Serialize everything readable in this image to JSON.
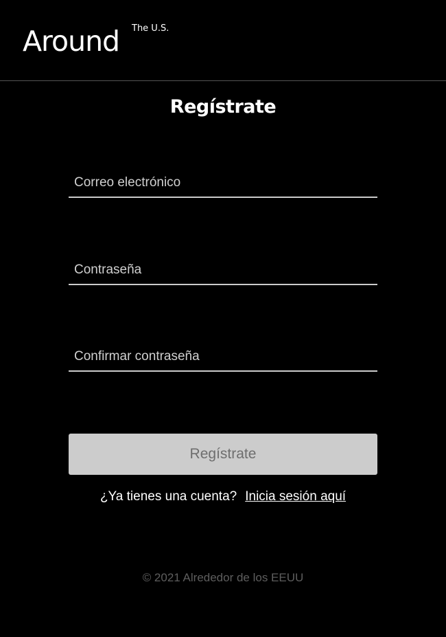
{
  "header": {
    "logo_text": "Around",
    "logo_superscript": "The U.S."
  },
  "form": {
    "title": "Regístrate",
    "email_placeholder": "Correo electrónico",
    "password_placeholder": "Contraseña",
    "confirm_password_placeholder": "Confirmar contraseña",
    "email_value": "",
    "password_value": "",
    "confirm_password_value": "",
    "submit_label": "Regístrate",
    "has_account_text": "¿Ya tienes una cuenta?",
    "login_link_text": "Inicia sesión aquí"
  },
  "footer": {
    "copyright": "© 2021 Alrededor de los EEUU"
  },
  "colors": {
    "background": "#000000",
    "text": "#ffffff",
    "divider": "#545454",
    "field_underline": "#cccccc",
    "button_background": "#cccccc",
    "button_text": "#6e6e6e",
    "footer_text": "#5e5e5e"
  }
}
